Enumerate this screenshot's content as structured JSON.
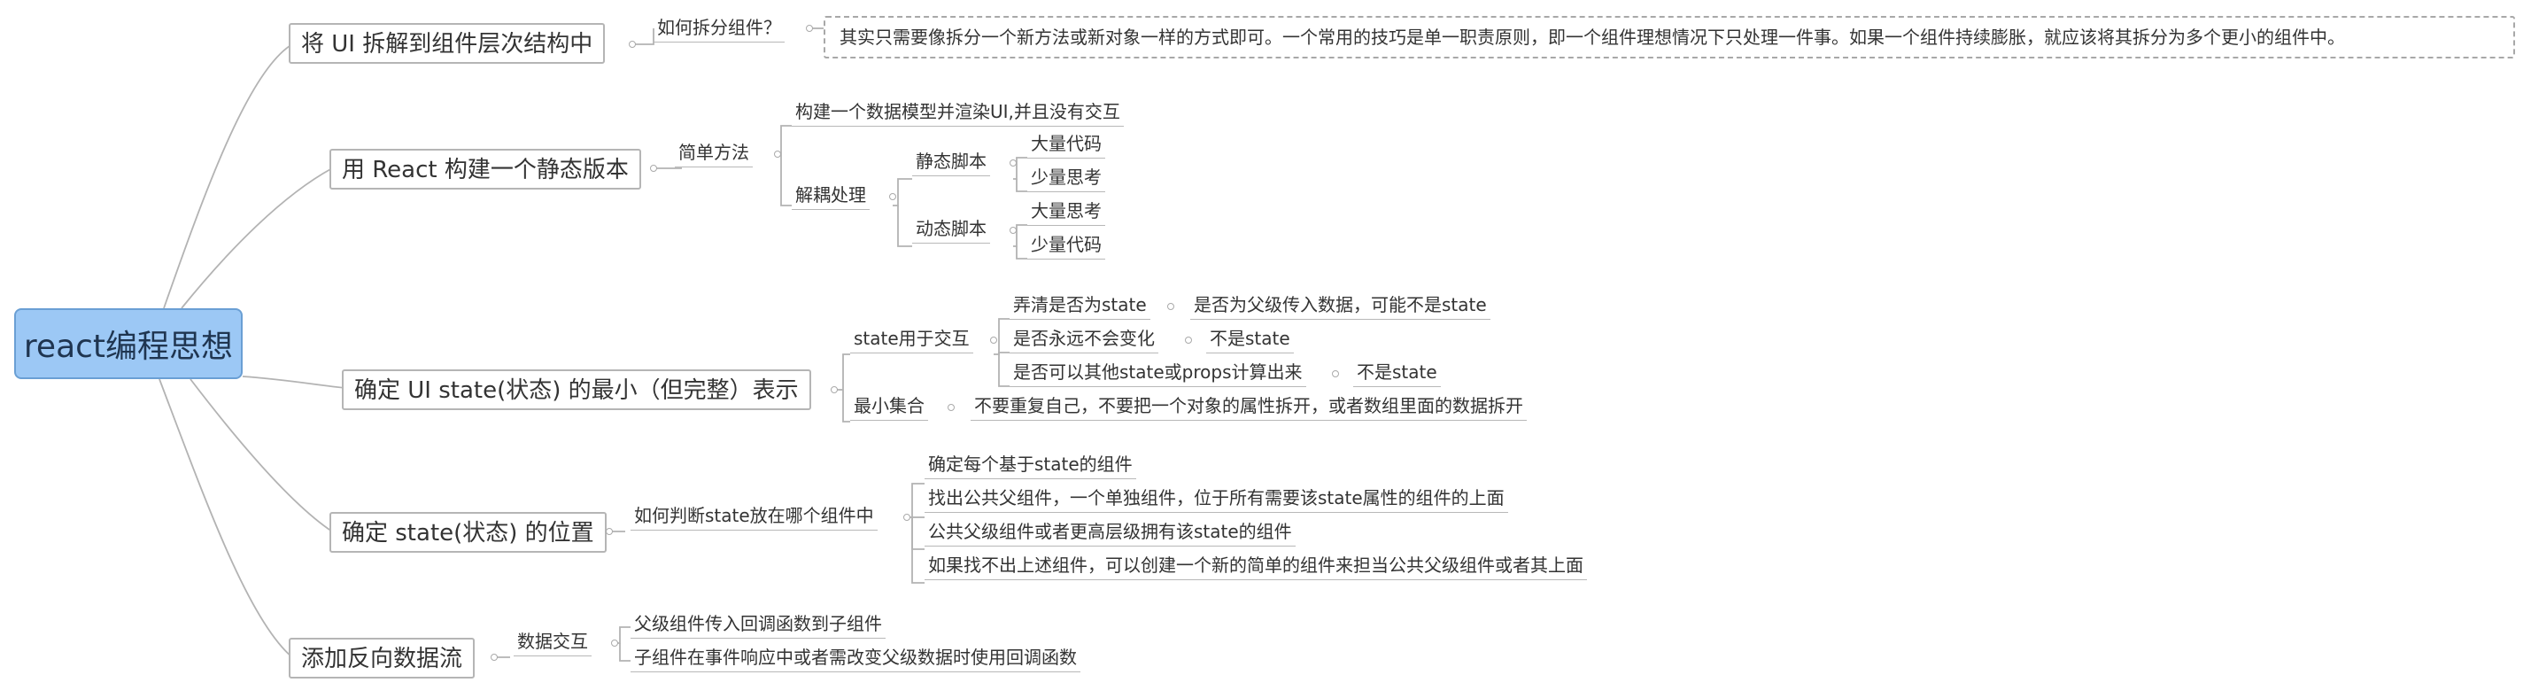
{
  "root": "react编程思想",
  "branches": [
    {
      "label": "将 UI 拆解到组件层次结构中",
      "sub": "如何拆分组件？",
      "note": "其实只需要像拆分一个新方法或新对象一样的方式即可。一个常用的技巧是单一职责原则，即一个组件理想情况下只处理一件事。如果一个组件持续膨胀，就应该将其拆分为多个更小的组件中。"
    },
    {
      "label": "用 React 构建一个静态版本",
      "sub": "简单方法",
      "items": [
        "构建一个数据模型并渲染UI,并且没有交互",
        "解耦处理"
      ],
      "decouple": [
        {
          "label": "静态脚本",
          "items": [
            "大量代码",
            "少量思考"
          ]
        },
        {
          "label": "动态脚本",
          "items": [
            "大量思考",
            "少量代码"
          ]
        }
      ]
    },
    {
      "label": "确定 UI state(状态) 的最小（但完整）表示",
      "groups": [
        {
          "label": "state用于交互",
          "items": [
            {
              "q": "弄清是否为state",
              "a": "是否为父级传入数据，可能不是state"
            },
            {
              "q": "是否永远不会变化",
              "a": "不是state"
            },
            {
              "q": "是否可以其他state或props计算出来",
              "a": "不是state"
            }
          ]
        },
        {
          "label": "最小集合",
          "detail": "不要重复自己，不要把一个对象的属性拆开，或者数组里面的数据拆开"
        }
      ]
    },
    {
      "label": "确定 state(状态) 的位置",
      "sub": "如何判断state放在哪个组件中",
      "items": [
        "确定每个基于state的组件",
        "找出公共父组件，一个单独组件，位于所有需要该state属性的组件的上面",
        "公共父级组件或者更高层级拥有该state的组件",
        "如果找不出上述组件，可以创建一个新的简单的组件来担当公共父级组件或者其上面"
      ]
    },
    {
      "label": "添加反向数据流",
      "sub": "数据交互",
      "items": [
        "父级组件传入回调函数到子组件",
        "子组件在事件响应中或者需改变父级数据时使用回调函数"
      ]
    }
  ]
}
